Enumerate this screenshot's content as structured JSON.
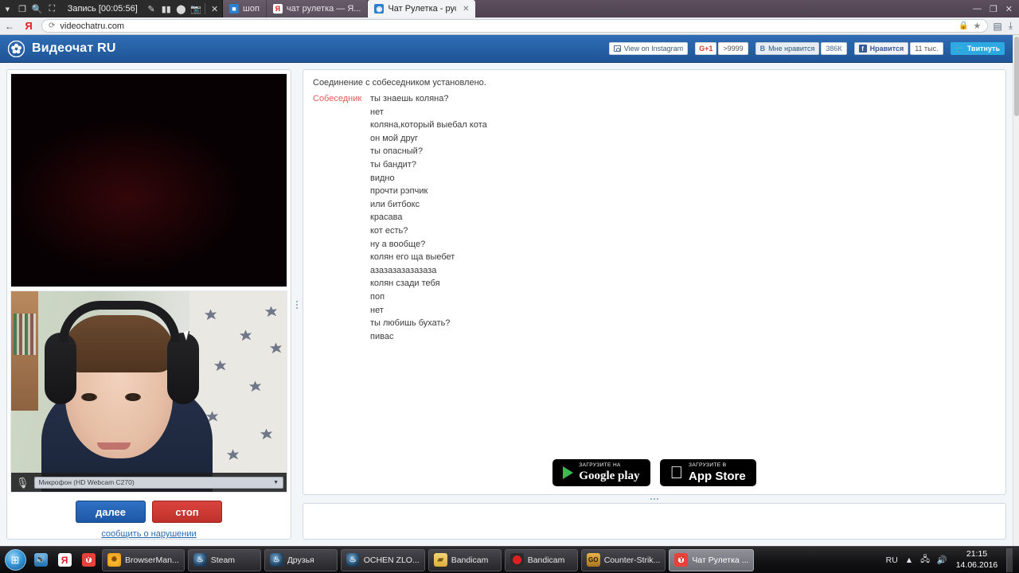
{
  "recorder": {
    "label": "Запись [00:05:56]",
    "icons": [
      "chevron-down-icon",
      "window-icon",
      "magnifier-icon",
      "rect-select-icon",
      "pencil-icon",
      "pause-icon",
      "record-icon",
      "camera-icon",
      "close-icon"
    ]
  },
  "browser": {
    "tabs": [
      {
        "title": "шоп",
        "favicon": "generic-icon",
        "active": false
      },
      {
        "title": "чат рулетка — Я...",
        "favicon": "yandex-icon",
        "active": false
      },
      {
        "title": "Чат Рулетка - рус",
        "favicon": "chat-icon",
        "active": true
      }
    ],
    "window_controls": [
      "minimize",
      "maximize",
      "close"
    ],
    "nav": {
      "back_icon": "arrow-left-icon",
      "yandex_icon": "yandex-icon",
      "reload_icon": "reload-icon",
      "url": "videochatru.com",
      "lock_icon": "lock-icon",
      "star_icon": "star-icon",
      "screenshot_icon": "screenshot-icon",
      "download_icon": "download-icon"
    }
  },
  "site": {
    "brand": "Видеочат RU",
    "social": {
      "instagram_label": "View on Instagram",
      "gplus_label": "G+1",
      "gplus_count": ">9999",
      "vk_label": "Мне нравится",
      "vk_mark": "В",
      "vk_count": "386К",
      "fb_label": "Нравится",
      "fb_mark": "f",
      "fb_count": "11 тыс.",
      "twitter_label": "Твитнуть"
    }
  },
  "video": {
    "mic_label": "Микрофон (HD Webcam C270)",
    "mic_icon": "microphone-icon",
    "caret": "▼"
  },
  "actions": {
    "next": "далее",
    "stop": "стоп",
    "report": "сообщить о нарушении"
  },
  "chat": {
    "system": "Соединение с собеседником установлено.",
    "speaker": "Собеседник",
    "messages": [
      "ты знаешь коляна?",
      "нет",
      "коляна,который выебал кота",
      "он мой друг",
      "ты опасный?",
      "ты бандит?",
      "видно",
      "прочти рэпчик",
      "или битбокс",
      "красава",
      "кот есть?",
      "ну а вообще?",
      "колян его ща выебет",
      "азазазазазазаза",
      "колян сзади тебя",
      "поп",
      "нет",
      "ты любишь бухать?",
      "пивас"
    ],
    "input_value": ""
  },
  "badges": {
    "google_top": "ЗАГРУЗИТЕ НА",
    "google_main": "Google play",
    "apple_top": "Загрузите в",
    "apple_main": "App Store"
  },
  "taskbar": {
    "start_icon": "windows-start-icon",
    "quicklaunch": [
      {
        "name": "speaker-icon"
      },
      {
        "name": "yandex-icon"
      },
      {
        "name": "yandex-browser-icon"
      }
    ],
    "tasks": [
      {
        "label": "BrowserMan...",
        "icon": "browsermanager-icon",
        "active": false
      },
      {
        "label": "Steam",
        "icon": "steam-icon",
        "active": false
      },
      {
        "label": "Друзья",
        "icon": "steam-icon",
        "active": false
      },
      {
        "label": "OCHEN ZLO...",
        "icon": "steam-icon",
        "active": false
      },
      {
        "label": "Bandicam",
        "icon": "folder-icon",
        "active": false
      },
      {
        "label": "Bandicam",
        "icon": "record-icon",
        "active": false
      },
      {
        "label": "Counter-Strik...",
        "icon": "csgo-icon",
        "active": false
      },
      {
        "label": "Чат Рулетка ...",
        "icon": "yandex-browser-icon",
        "active": true
      }
    ],
    "tray": {
      "language": "RU",
      "up_icon": "chevron-up-icon",
      "network_icon": "network-icon",
      "volume_icon": "volume-icon",
      "time": "21:15",
      "date": "14.06.2016"
    }
  }
}
